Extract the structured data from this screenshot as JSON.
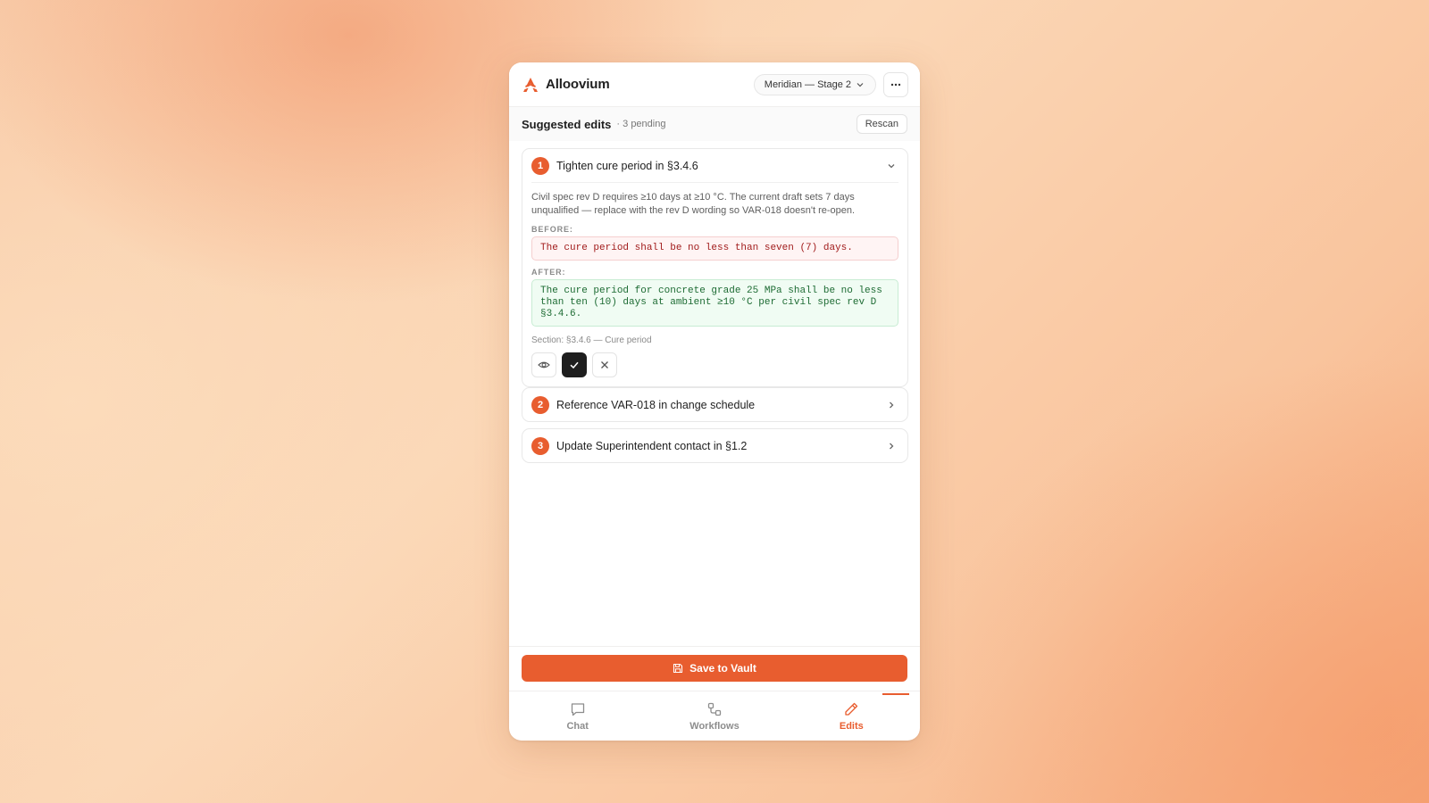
{
  "header": {
    "brand": "Alloovium",
    "project": "Meridian — Stage 2"
  },
  "subheader": {
    "title": "Suggested edits",
    "count": "· 3 pending",
    "rescan_label": "Rescan"
  },
  "edits": [
    {
      "number": "1",
      "title": "Tighten cure period in §3.4.6",
      "expanded": true,
      "description": "Civil spec rev D requires ≥10 days at ≥10 °C. The current draft sets 7 days unqualified — replace with the rev D wording so VAR-018 doesn't re-open.",
      "before_label": "BEFORE:",
      "before": "The cure period shall be no less than seven (7) days.",
      "after_label": "AFTER:",
      "after": "The cure period for concrete grade 25 MPa shall be no less than ten (10) days at ambient ≥10 °C per civil spec rev D §3.4.6.",
      "section": "Section: §3.4.6 — Cure period"
    },
    {
      "number": "2",
      "title": "Reference VAR-018 in change schedule",
      "expanded": false
    },
    {
      "number": "3",
      "title": "Update Superintendent contact in §1.2",
      "expanded": false
    }
  ],
  "footer": {
    "save_label": "Save to Vault"
  },
  "tabs": [
    {
      "label": "Chat",
      "active": false
    },
    {
      "label": "Workflows",
      "active": false
    },
    {
      "label": "Edits",
      "active": true
    }
  ],
  "colors": {
    "accent": "#e85d2f",
    "before_text": "#a11c1c",
    "after_text": "#1d6b33"
  }
}
